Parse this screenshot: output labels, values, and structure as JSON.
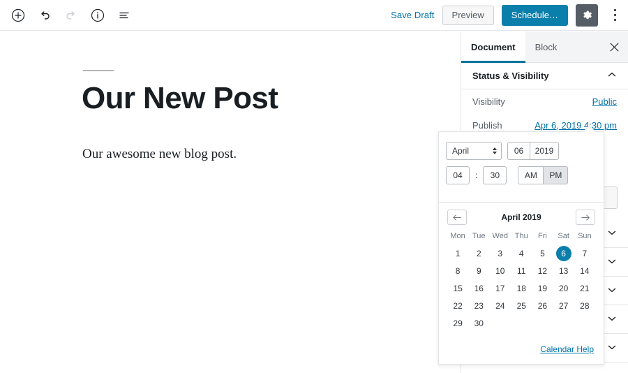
{
  "header": {
    "left_tools": [
      {
        "name": "add-block-icon",
        "label": "Add block"
      },
      {
        "name": "undo-icon",
        "label": "Undo"
      },
      {
        "name": "redo-icon",
        "label": "Redo"
      },
      {
        "name": "info-icon",
        "label": "Content structure"
      },
      {
        "name": "block-navigation-icon",
        "label": "Block navigation"
      }
    ],
    "save_draft_label": "Save Draft",
    "preview_label": "Preview",
    "schedule_label": "Schedule…",
    "settings_icon": "gear-icon",
    "more_icon": "kebab-menu-icon"
  },
  "editor": {
    "post_title": "Our New Post",
    "post_body": "Our awesome new blog post."
  },
  "sidebar": {
    "tabs": [
      {
        "label": "Document",
        "active": true
      },
      {
        "label": "Block",
        "active": false
      }
    ],
    "close_icon": "close-icon",
    "panels": [
      {
        "title": "Status & Visibility",
        "expanded": true,
        "chevron": "chevron-up-icon"
      }
    ],
    "rows": [
      {
        "label": "Visibility",
        "value": "Public"
      },
      {
        "label": "Publish",
        "value": "Apr 6, 2019 4:30 pm"
      }
    ],
    "collapsed_panels": [
      {
        "chevron": "chevron-down-icon"
      },
      {
        "chevron": "chevron-down-icon"
      },
      {
        "chevron": "chevron-down-icon"
      },
      {
        "chevron": "chevron-down-icon"
      },
      {
        "chevron": "chevron-down-icon"
      }
    ]
  },
  "date_popover": {
    "month_value": "April",
    "day_value": "06",
    "year_value": "2019",
    "hour_value": "04",
    "minute_value": "30",
    "time_separator": ":",
    "am_label": "AM",
    "pm_label": "PM",
    "meridiem_selected": "PM",
    "prev_month_icon": "arrow-left-icon",
    "next_month_icon": "arrow-right-icon",
    "calendar_title": "April 2019",
    "weekdays": [
      "Mon",
      "Tue",
      "Wed",
      "Thu",
      "Fri",
      "Sat",
      "Sun"
    ],
    "weeks": [
      [
        "1",
        "2",
        "3",
        "4",
        "5",
        "6",
        "7"
      ],
      [
        "8",
        "9",
        "10",
        "11",
        "12",
        "13",
        "14"
      ],
      [
        "15",
        "16",
        "17",
        "18",
        "19",
        "20",
        "21"
      ],
      [
        "22",
        "23",
        "24",
        "25",
        "26",
        "27",
        "28"
      ],
      [
        "29",
        "30",
        "",
        "",
        "",
        "",
        ""
      ]
    ],
    "selected_day": "6",
    "help_label": "Calendar Help"
  },
  "colors": {
    "accent_blue": "#0b7fab",
    "link_blue": "#0073aa",
    "tab_underline": "#00739c",
    "gear_bg": "#555d66",
    "border": "#e2e4e7",
    "text": "#191e23"
  }
}
